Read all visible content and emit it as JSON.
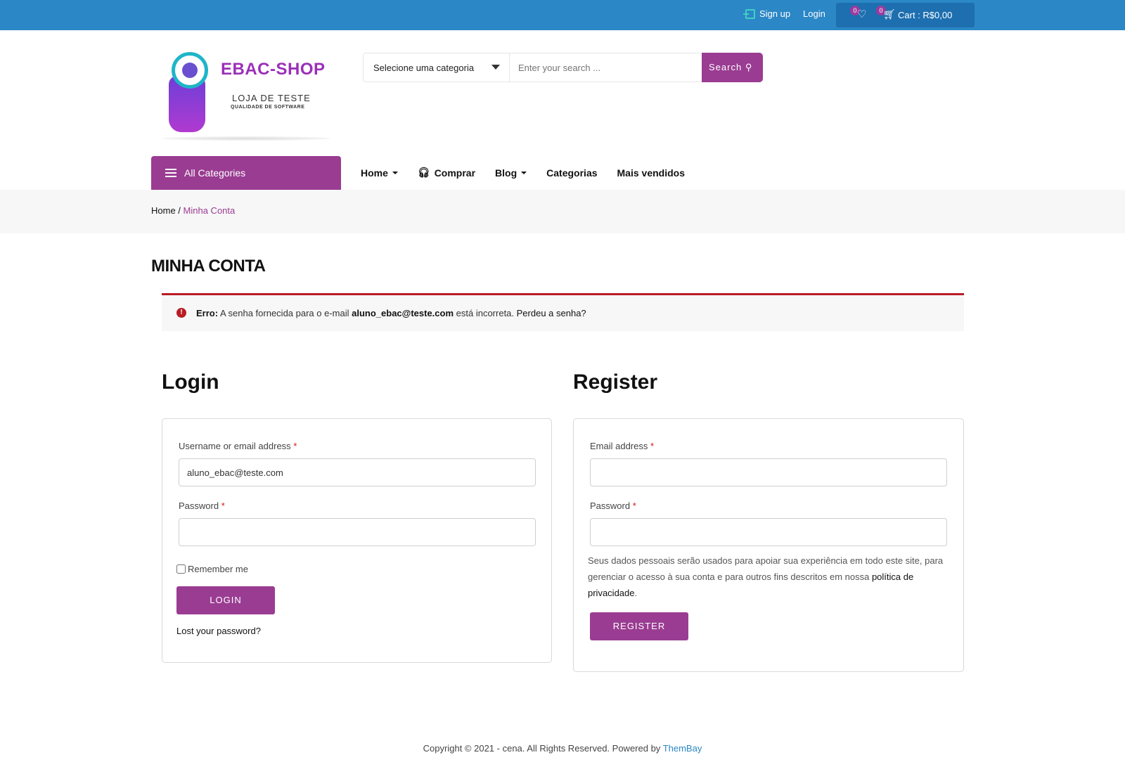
{
  "topbar": {
    "signup": "Sign up",
    "login": "Login",
    "wishlist_count": "0",
    "cart_count": "0",
    "cart_label": "Cart : R$0,00"
  },
  "logo": {
    "brand": "EBAC-SHOP",
    "tagline1": "LOJA DE TESTE",
    "tagline2": "QUALIDADE DE SOFTWARE"
  },
  "search": {
    "category": "Selecione uma categoria",
    "placeholder": "Enter your search ...",
    "button": "Search"
  },
  "nav": {
    "all_categories": "All Categories",
    "items": [
      "Home",
      "Comprar",
      "Blog",
      "Categorias",
      "Mais vendidos"
    ]
  },
  "breadcrumb": {
    "home": "Home",
    "sep": " / ",
    "current": "Minha Conta"
  },
  "page_title": "MINHA CONTA",
  "notice": {
    "prefix": "Erro:",
    "text1": " A senha fornecida para o e-mail ",
    "email": "aluno_ebac@teste.com",
    "text2": " está incorreta. ",
    "link": "Perdeu a senha?"
  },
  "login": {
    "title": "Login",
    "username_label": "Username or email address",
    "username_value": "aluno_ebac@teste.com",
    "password_label": "Password",
    "remember": "Remember me",
    "button": "LOGIN",
    "lost": "Lost your password?"
  },
  "register": {
    "title": "Register",
    "email_label": "Email address",
    "password_label": "Password",
    "privacy_text": "Seus dados pessoais serão usados para apoiar sua experiência em todo este site, para gerenciar o acesso à sua conta e para outros fins descritos em nossa ",
    "privacy_link": "política de privacidade",
    "privacy_end": ".",
    "button": "REGISTER"
  },
  "required_mark": "*",
  "footer": {
    "text": "Copyright © 2021 - cena. All Rights Reserved. Powered by ",
    "link": "ThemBay"
  },
  "colors": {
    "topbar": "#2b87c6",
    "accent": "#9a3c92",
    "error": "#b81c23"
  }
}
